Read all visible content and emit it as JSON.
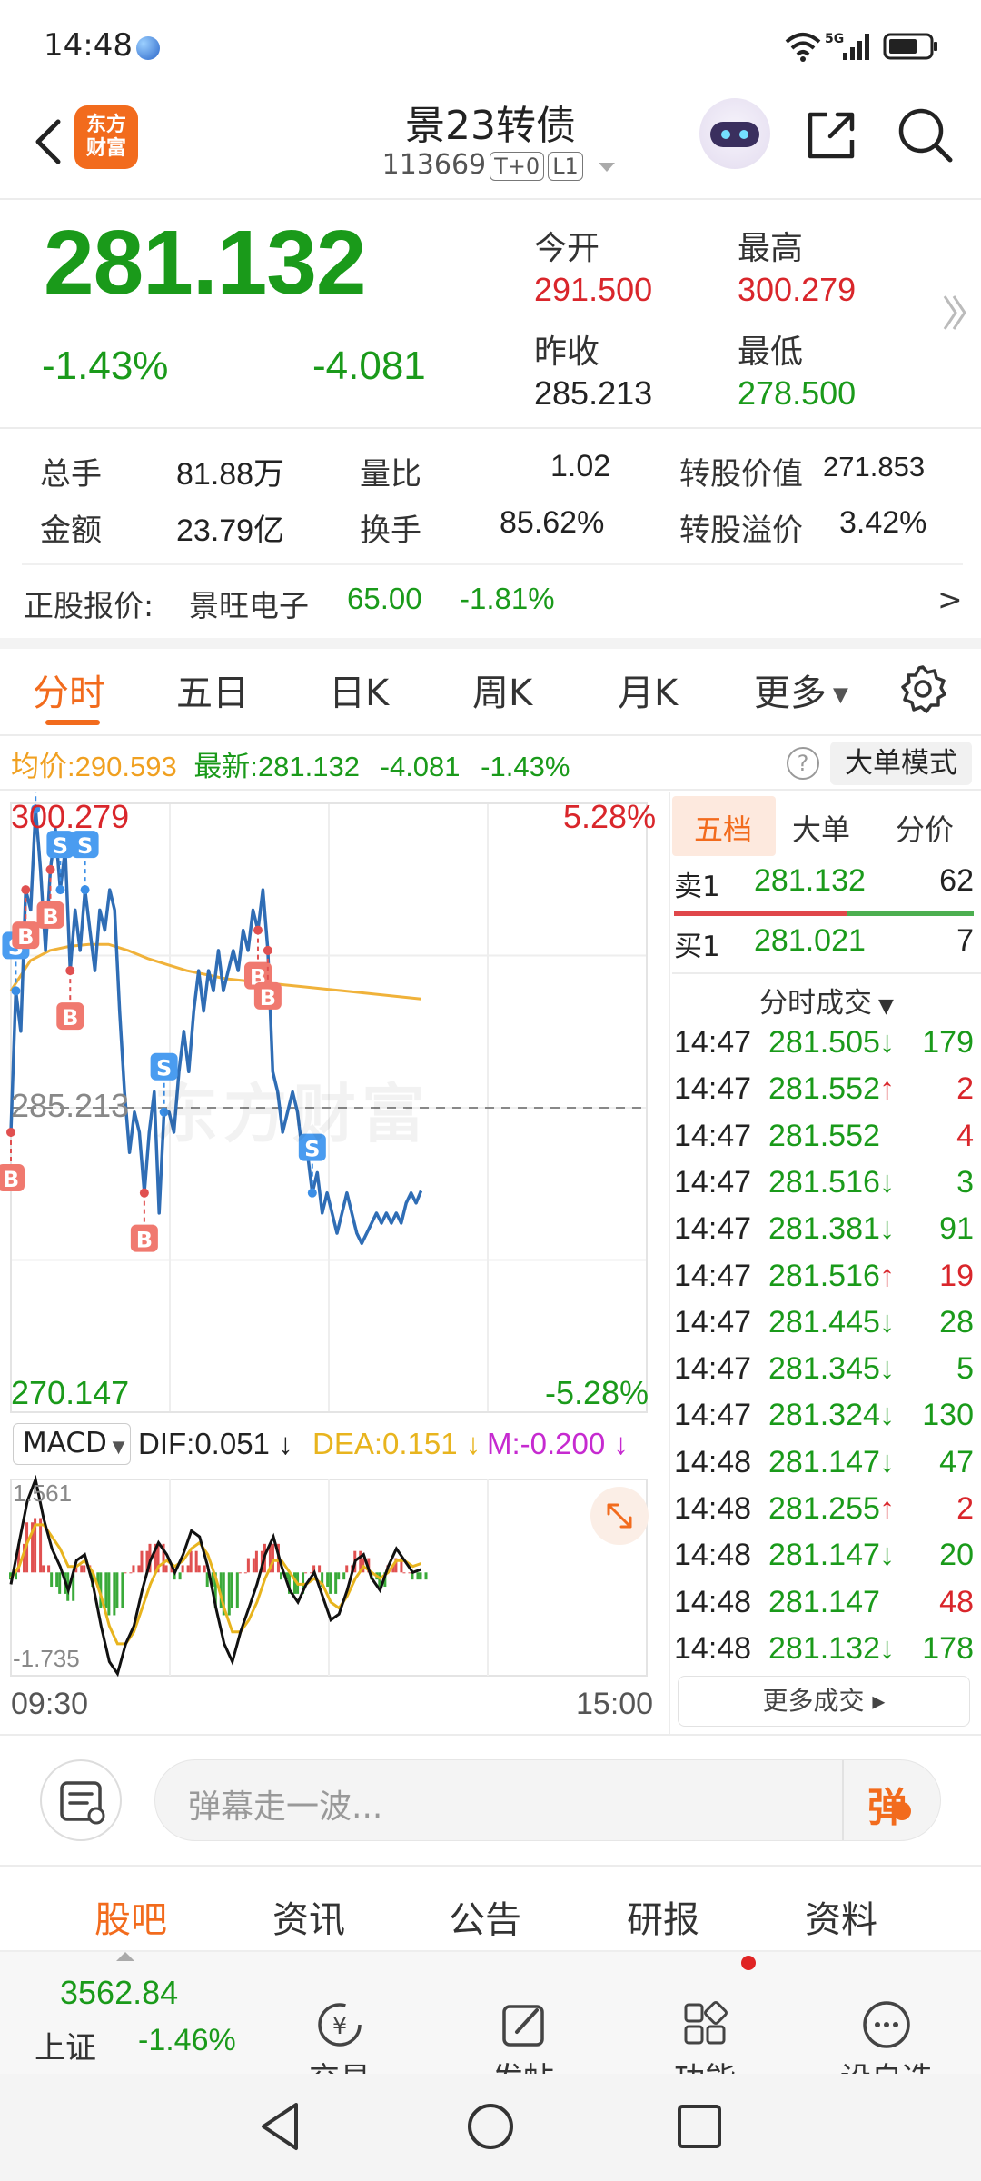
{
  "status_bar": {
    "time": "14:48",
    "network": "5G"
  },
  "header": {
    "title": "景23转债",
    "code": "113669",
    "tag1": "T+0",
    "tag2": "L1",
    "logo_line1": "东方",
    "logo_line2": "财富"
  },
  "quote": {
    "price": "281.132",
    "change_pct": "-1.43%",
    "change": "-4.081",
    "open_label": "今开",
    "open": "291.500",
    "high_label": "最高",
    "high": "300.279",
    "prev_close_label": "昨收",
    "prev_close": "285.213",
    "low_label": "最低",
    "low": "278.500"
  },
  "stats": {
    "volume_label": "总手",
    "volume": "81.88万",
    "vol_ratio_label": "量比",
    "vol_ratio": "1.02",
    "conv_value_label": "转股价值",
    "conv_value": "271.853",
    "amount_label": "金额",
    "amount": "23.79亿",
    "turnover_label": "换手",
    "turnover": "85.62%",
    "premium_label": "转股溢价",
    "premium": "3.42%"
  },
  "underlying": {
    "label": "正股报价:",
    "name": "景旺电子",
    "price": "65.00",
    "change": "-1.81%",
    "arrow": ">"
  },
  "kline_tabs": [
    "分时",
    "五日",
    "日K",
    "周K",
    "月K",
    "更多"
  ],
  "indicator": {
    "avg_label": "均价:",
    "avg": "290.593",
    "latest_label": "最新:",
    "latest": "281.132",
    "change": "-4.081",
    "change_pct": "-1.43%",
    "help": "?",
    "big_order_mode": "大单模式"
  },
  "chart_data": {
    "type": "line",
    "title": "",
    "y_top_label": "300.279",
    "y_mid_label": "285.213",
    "y_bottom_label": "270.147",
    "pct_top": "5.28%",
    "pct_bottom": "-5.28%",
    "x_start": "09:30",
    "x_end": "15:00",
    "ylim": [
      270.147,
      300.279
    ],
    "watermark": "东方财富",
    "series": [
      {
        "values": [
          284,
          291,
          289,
          296,
          295,
          300,
          297,
          293,
          297,
          299,
          296,
          298,
          292,
          295,
          293,
          296,
          294,
          292,
          295,
          294,
          296,
          295,
          290,
          286,
          283,
          285,
          284,
          281,
          284,
          286,
          280,
          285,
          285,
          284,
          287,
          289,
          287,
          290,
          292,
          290,
          292,
          291,
          293,
          291,
          292,
          293,
          292,
          294,
          293,
          295,
          294,
          296,
          293,
          287,
          286,
          284,
          285,
          286,
          285,
          283,
          283,
          281,
          282,
          280,
          281,
          280,
          279,
          280,
          281,
          280,
          279,
          278.5,
          279,
          279.5,
          280,
          279.5,
          280,
          279.5,
          280,
          279.5,
          280.5,
          281,
          280.5,
          281.1
        ]
      },
      {
        "values": [
          291,
          292.5,
          293,
          293.2,
          293.3,
          293.3,
          293.0,
          292.6,
          292.3,
          292.0,
          291.8,
          291.6,
          291.5,
          291.4,
          291.3,
          291.2,
          291.1,
          291.0,
          290.9,
          290.8,
          290.7,
          290.6
        ]
      }
    ],
    "markers": [
      "B",
      "S",
      "B",
      "S",
      "B",
      "S",
      "B",
      "S",
      "B",
      "S",
      "B",
      "B",
      "S"
    ]
  },
  "macd": {
    "selector": "MACD",
    "dif": "DIF:0.051",
    "dea": "DEA:0.151",
    "m": "M:-0.200",
    "y_top": "1.561",
    "y_bottom": "-1.735",
    "dif_values": [
      -0.2,
      0.5,
      1.2,
      1.56,
      0.9,
      0.4,
      0.1,
      -0.3,
      0.2,
      0.3,
      -0.2,
      -0.9,
      -1.5,
      -1.7,
      -1.2,
      -0.9,
      -0.3,
      0.2,
      0.5,
      0.3,
      0.0,
      0.3,
      0.7,
      0.6,
      0.1,
      -0.6,
      -1.2,
      -1.5,
      -1.0,
      -0.6,
      -0.2,
      0.3,
      0.6,
      0.1,
      -0.3,
      -0.5,
      -0.2,
      0.0,
      -0.4,
      -0.8,
      -0.7,
      -0.3,
      0.2,
      0.3,
      -0.1,
      -0.3,
      0.1,
      0.4,
      0.2,
      0.0,
      0.05
    ],
    "dea_values": [
      -0.1,
      0.1,
      0.5,
      0.8,
      0.8,
      0.6,
      0.4,
      0.1,
      0.1,
      0.2,
      0.0,
      -0.4,
      -0.9,
      -1.2,
      -1.2,
      -1.0,
      -0.6,
      -0.2,
      0.1,
      0.2,
      0.1,
      0.2,
      0.4,
      0.5,
      0.3,
      -0.1,
      -0.6,
      -1.0,
      -1.0,
      -0.8,
      -0.5,
      -0.1,
      0.2,
      0.2,
      0.0,
      -0.2,
      -0.2,
      -0.1,
      -0.2,
      -0.5,
      -0.6,
      -0.4,
      -0.1,
      0.1,
      0.0,
      -0.1,
      0.0,
      0.2,
      0.2,
      0.1,
      0.15
    ]
  },
  "side_tabs": [
    "五档",
    "大单",
    "分价"
  ],
  "order_book": [
    {
      "label": "卖1",
      "price": "281.132",
      "qty": "62"
    },
    {
      "label": "买1",
      "price": "281.021",
      "qty": "7"
    }
  ],
  "trades_title": "分时成交",
  "trades": [
    {
      "time": "14:47",
      "price": "281.505",
      "dir": "↓",
      "qty": "179",
      "color": "#1a9a1a"
    },
    {
      "time": "14:47",
      "price": "281.552",
      "dir": "↑",
      "qty": "2",
      "color": "#d9262b"
    },
    {
      "time": "14:47",
      "price": "281.552",
      "dir": "",
      "qty": "4",
      "color": "#d9262b"
    },
    {
      "time": "14:47",
      "price": "281.516",
      "dir": "↓",
      "qty": "3",
      "color": "#1a9a1a"
    },
    {
      "time": "14:47",
      "price": "281.381",
      "dir": "↓",
      "qty": "91",
      "color": "#1a9a1a"
    },
    {
      "time": "14:47",
      "price": "281.516",
      "dir": "↑",
      "qty": "19",
      "color": "#d9262b"
    },
    {
      "time": "14:47",
      "price": "281.445",
      "dir": "↓",
      "qty": "28",
      "color": "#1a9a1a"
    },
    {
      "time": "14:47",
      "price": "281.345",
      "dir": "↓",
      "qty": "5",
      "color": "#1a9a1a"
    },
    {
      "time": "14:47",
      "price": "281.324",
      "dir": "↓",
      "qty": "130",
      "color": "#1a9a1a"
    },
    {
      "time": "14:48",
      "price": "281.147",
      "dir": "↓",
      "qty": "47",
      "color": "#1a9a1a"
    },
    {
      "time": "14:48",
      "price": "281.255",
      "dir": "↑",
      "qty": "2",
      "color": "#d9262b"
    },
    {
      "time": "14:48",
      "price": "281.147",
      "dir": "↓",
      "qty": "20",
      "color": "#1a9a1a"
    },
    {
      "time": "14:48",
      "price": "281.147",
      "dir": "",
      "qty": "48",
      "color": "#d9262b"
    },
    {
      "time": "14:48",
      "price": "281.132",
      "dir": "↓",
      "qty": "178",
      "color": "#1a9a1a"
    }
  ],
  "more_trades": "更多成交 ▸",
  "comment": {
    "placeholder": "弹幕走一波...",
    "send": "弹"
  },
  "bottom_tabs": [
    "股吧",
    "资讯",
    "公告",
    "研报",
    "资料"
  ],
  "index": {
    "value": "3562.84",
    "name": "上证",
    "change": "-1.46%"
  },
  "nav": [
    "交易",
    "发帖",
    "功能",
    "设自选"
  ],
  "colors": {
    "red": "#d9262b",
    "green": "#1a9a1a",
    "accent": "#f26b1d",
    "price_line": "#2f6db5",
    "avg_line": "#f0b23a"
  }
}
